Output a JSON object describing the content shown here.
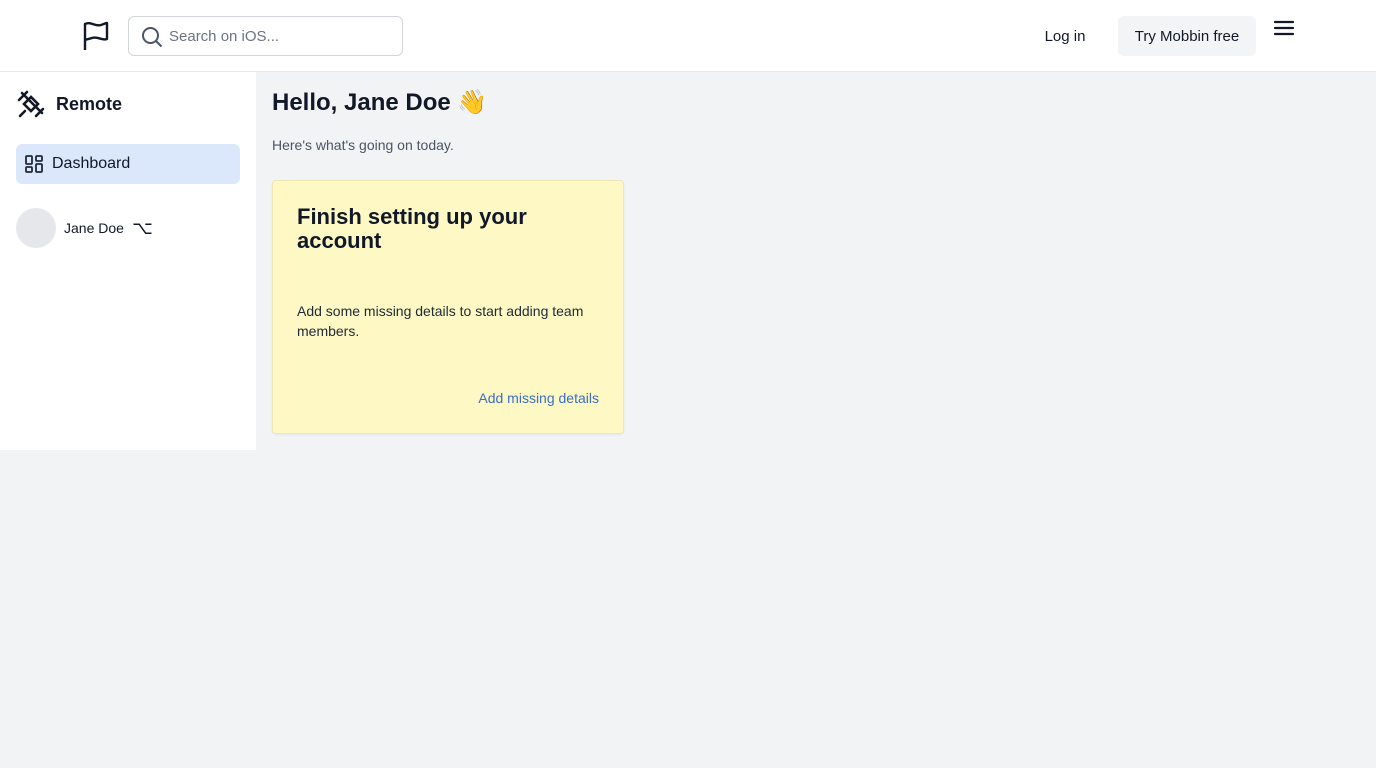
{
  "header": {
    "search_placeholder": "Search on iOS...",
    "login_label": "Log in",
    "try_label": "Try Mobbin free"
  },
  "sidebar": {
    "brand_name": "Remote",
    "nav_dashboard": "Dashboard",
    "user_name": "Jane Doe",
    "option_key": "⌥"
  },
  "main": {
    "greeting": "Hello, Jane Doe 👋",
    "subtext": "Here's what's going on today.",
    "card": {
      "title": "Finish setting up your account",
      "body": "Add some missing details to start adding team members.",
      "link": "Add missing details"
    }
  },
  "colors": {
    "accent_nav_bg": "#dbe8fb",
    "card_bg": "#fdf8c4",
    "link": "#3b6fc4"
  },
  "icons": [
    "flag-icon",
    "search-icon",
    "menu-icon",
    "remote-logo-icon",
    "dashboard-icon"
  ]
}
